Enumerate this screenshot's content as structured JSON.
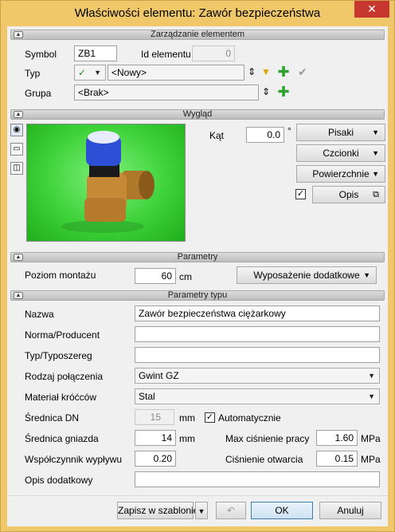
{
  "window": {
    "title": "Właściwości elementu: Zawór bezpieczeństwa",
    "close": "✕"
  },
  "sections": {
    "management": "Zarządzanie elementem",
    "appearance": "Wygląd",
    "parameters": "Parametry",
    "type_parameters": "Parametry typu"
  },
  "management": {
    "symbol_label": "Symbol",
    "symbol_value": "ZB1",
    "id_label": "Id elementu",
    "id_value": "0",
    "type_label": "Typ",
    "type_check": "✓",
    "type_value": "<Nowy>",
    "group_label": "Grupa",
    "group_value": "<Brak>"
  },
  "appearance": {
    "angle_label": "Kąt",
    "angle_value": "0.0",
    "angle_unit": "°",
    "pens": "Pisaki",
    "fonts": "Czcionki",
    "surfaces": "Powierzchnie",
    "desc_checked": "✓",
    "desc": "Opis"
  },
  "parameters": {
    "mount_label": "Poziom montażu",
    "mount_value": "60",
    "mount_unit": "cm",
    "equipment": "Wyposażenie dodatkowe"
  },
  "type_params": {
    "name_label": "Nazwa",
    "name_value": "Zawór bezpieczeństwa ciężarkowy",
    "norm_label": "Norma/Producent",
    "norm_value": "",
    "series_label": "Typ/Typoszereg",
    "series_value": "",
    "conn_label": "Rodzaj połączenia",
    "conn_value": "Gwint GZ",
    "material_label": "Materiał króćców",
    "material_value": "Stal",
    "dn_label": "Średnica DN",
    "dn_value": "15",
    "dn_unit": "mm",
    "auto_checked": "✓",
    "auto_label": "Automatycznie",
    "seat_label": "Średnica gniazda",
    "seat_value": "14",
    "seat_unit": "mm",
    "maxp_label": "Max ciśnienie pracy",
    "maxp_value": "1.60",
    "maxp_unit": "MPa",
    "flow_label": "Współczynnik wypływu",
    "flow_value": "0.20",
    "openp_label": "Ciśnienie otwarcia",
    "openp_value": "0.15",
    "openp_unit": "MPa",
    "extra_label": "Opis dodatkowy",
    "extra_value": ""
  },
  "footer": {
    "save_template": "Zapisz w szablonie",
    "ok": "OK",
    "cancel": "Anuluj"
  }
}
